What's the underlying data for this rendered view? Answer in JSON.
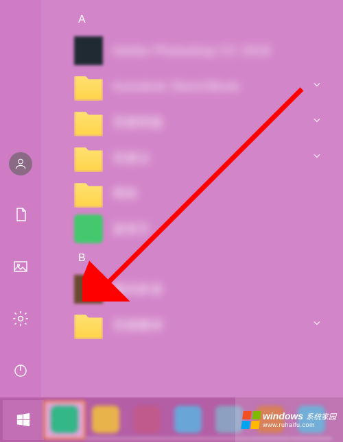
{
  "sections": {
    "a": {
      "header": "A"
    },
    "b": {
      "header": "B"
    }
  },
  "side_rail": {
    "user": "User account",
    "documents": "Documents",
    "pictures": "Pictures",
    "settings": "Settings",
    "power": "Power"
  },
  "apps_a": [
    {
      "label": "Adobe Photoshop CC 2018",
      "icon": "dark-square",
      "expandable": false
    },
    {
      "label": "Autodesk SketchBook",
      "icon": "folder",
      "expandable": true
    },
    {
      "label": "百度网盘",
      "icon": "folder",
      "expandable": true
    },
    {
      "label": "百度云",
      "icon": "folder",
      "expandable": true
    },
    {
      "label": "帮助",
      "icon": "folder",
      "expandable": false
    },
    {
      "label": "爱奇艺",
      "icon": "green-square",
      "expandable": false
    }
  ],
  "apps_b": [
    {
      "label": "暴风影音",
      "icon": "brown-square",
      "expandable": false
    },
    {
      "label": "百度翻译",
      "icon": "folder",
      "expandable": true
    }
  ],
  "taskbar": {
    "start": "Start",
    "icons": [
      {
        "color": "#33b688",
        "active": true
      },
      {
        "color": "#e8b34b",
        "active": false
      },
      {
        "color": "#c15a8c",
        "active": false
      },
      {
        "color": "#6aa5d8",
        "active": false
      },
      {
        "color": "#8ea0c2",
        "active": false
      },
      {
        "color": "#d06a3d",
        "active": false
      },
      {
        "color": "#5aa0d0",
        "active": false
      }
    ]
  },
  "watermark": {
    "line1_a": "windows",
    "line1_b": "系统家园",
    "line2": "www.ruhaifu.com"
  },
  "annotation": {
    "description": "red-arrow pointing to settings gear"
  },
  "colors": {
    "accent": "#d27ec7",
    "arrow": "#ff0000"
  }
}
